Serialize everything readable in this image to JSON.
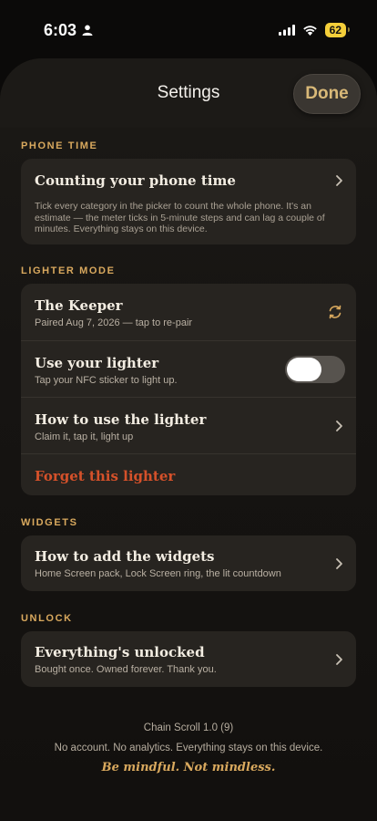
{
  "status": {
    "time": "6:03",
    "battery": "62"
  },
  "header": {
    "title": "Settings",
    "done_label": "Done"
  },
  "phone_time": {
    "section_title": "PHONE TIME",
    "row_title": "Counting your phone time",
    "note": "Tick every category in the picker to count the whole phone. It's an estimate — the meter ticks in 5-minute steps and can lag a couple of minutes. Everything stays on this device."
  },
  "lighter": {
    "section_title": "LIGHTER MODE",
    "keeper_title": "The Keeper",
    "keeper_sub": "Paired Aug 7, 2026 — tap to re-pair",
    "use_title": "Use your lighter",
    "use_sub": "Tap your NFC sticker to light up.",
    "use_enabled": false,
    "howto_title": "How to use the lighter",
    "howto_sub": "Claim it, tap it, light up",
    "forget_label": "Forget this lighter"
  },
  "widgets": {
    "section_title": "WIDGETS",
    "row_title": "How to add the widgets",
    "row_sub": "Home Screen pack, Lock Screen ring, the lit countdown"
  },
  "unlock": {
    "section_title": "UNLOCK",
    "row_title": "Everything's unlocked",
    "row_sub": "Bought once. Owned forever. Thank you."
  },
  "footer": {
    "version": "Chain Scroll 1.0 (9)",
    "privacy": "No account. No analytics. Everything stays on this device.",
    "tagline": "Be mindful. Not mindless."
  },
  "colors": {
    "accent": "#d9a95e",
    "danger": "#d5512a",
    "card": "#272420"
  }
}
